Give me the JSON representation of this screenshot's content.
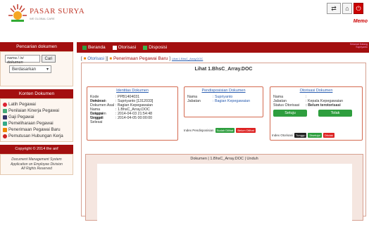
{
  "header": {
    "brand": "PASAR SURYA",
    "tagline": "WE GLOBAL CARE",
    "memo": "Memo"
  },
  "nav": {
    "items": [
      {
        "label": "Beranda",
        "color": "#2e9e3e"
      },
      {
        "label": "Otorisasi",
        "color": "#ffffff"
      },
      {
        "label": "Disposisi",
        "color": "#3cb44b"
      }
    ],
    "greeting_line1": "Selamat Datang",
    "greeting_line2": "Supriyanto"
  },
  "breadcrumb": {
    "first": "Otorisasi",
    "active": "Penerimaan Pegawai Baru",
    "file": "Lihat 1.BhsC_Array.DOC"
  },
  "sidebar": {
    "search_title": "Pencarian dokumen",
    "search_placeholder": "nama / isi dokumen",
    "search_button": "Cari",
    "search_select": "Berdasarkan",
    "menu_title": "Konten Dokumen",
    "menu_items": [
      {
        "label": "Latih Pegawai",
        "icon": "red-circle-icon",
        "color": "#d23"
      },
      {
        "label": "Penilaian Kinerja Pegawai",
        "icon": "document-icon",
        "color": "#4a7"
      },
      {
        "label": "Gaji Pegawai",
        "icon": "folder-icon",
        "color": "#336"
      },
      {
        "label": "Pemeliharaan Pegawai",
        "icon": "note-icon",
        "color": "#3a8"
      },
      {
        "label": "Penerimaan Pegawai Baru",
        "icon": "person-icon",
        "color": "#e80"
      },
      {
        "label": "Pemutusan Hubungan Kerja",
        "icon": "stop-icon",
        "color": "#c22"
      }
    ],
    "footer_title": "Copyright © 2014 the anf",
    "footer_lines": [
      "Document Management System",
      "Application on Employee Division",
      "All Rights Reserved"
    ]
  },
  "content": {
    "doc_title": "Lihat 1.BhsC_Array.DOC",
    "meta": {
      "title": "Identitas Dokumen",
      "rows": [
        {
          "k": "Kode Dokumen",
          "v": ": PPB1404031"
        },
        {
          "k": "Pembuat",
          "v": ": Supriyanto [1312033]"
        },
        {
          "k": "Dokumen Asal",
          "v": ": Bagian Kepegawaian"
        },
        {
          "k": "Nama Dokumen",
          "v": ": 1.BhsC_Array.DOC"
        },
        {
          "k": "Tanggal Unggah",
          "v": ": 2014-04-03 21:54:48"
        },
        {
          "k": "Tanggal Selesai",
          "v": ": 2014-04-05 00:00:00"
        }
      ]
    },
    "disposisi": {
      "title": "Pendisposisian Dokumen",
      "rows": [
        {
          "k": "Nama",
          "v": ": Supriyanto"
        },
        {
          "k": "Jabatan",
          "v": ": Bagian Kepegawaian"
        }
      ],
      "index_label": "Index Pendisposisian",
      "badge_done": "Sudah Dilihat",
      "badge_not": "Belum Dilihat"
    },
    "otorisasi": {
      "title": "Otorisasi Dokumen",
      "rows": [
        {
          "k": "Nama",
          "v": ":"
        },
        {
          "k": "Jabatan",
          "v": ": Kepala Kepegawaian"
        },
        {
          "k": "Status Otorisasi",
          "v": ": Belum terotorisasi"
        }
      ],
      "approve": "Setuju",
      "reject": "Tolak",
      "index_label": "Index Otorisasi",
      "badge_wait": "Tunggu",
      "badge_ok": "Disetujui",
      "badge_no": "Ditolak"
    },
    "viewer_title": "Dokumen | 1.BhsC_Array.DOC | Unduh"
  }
}
